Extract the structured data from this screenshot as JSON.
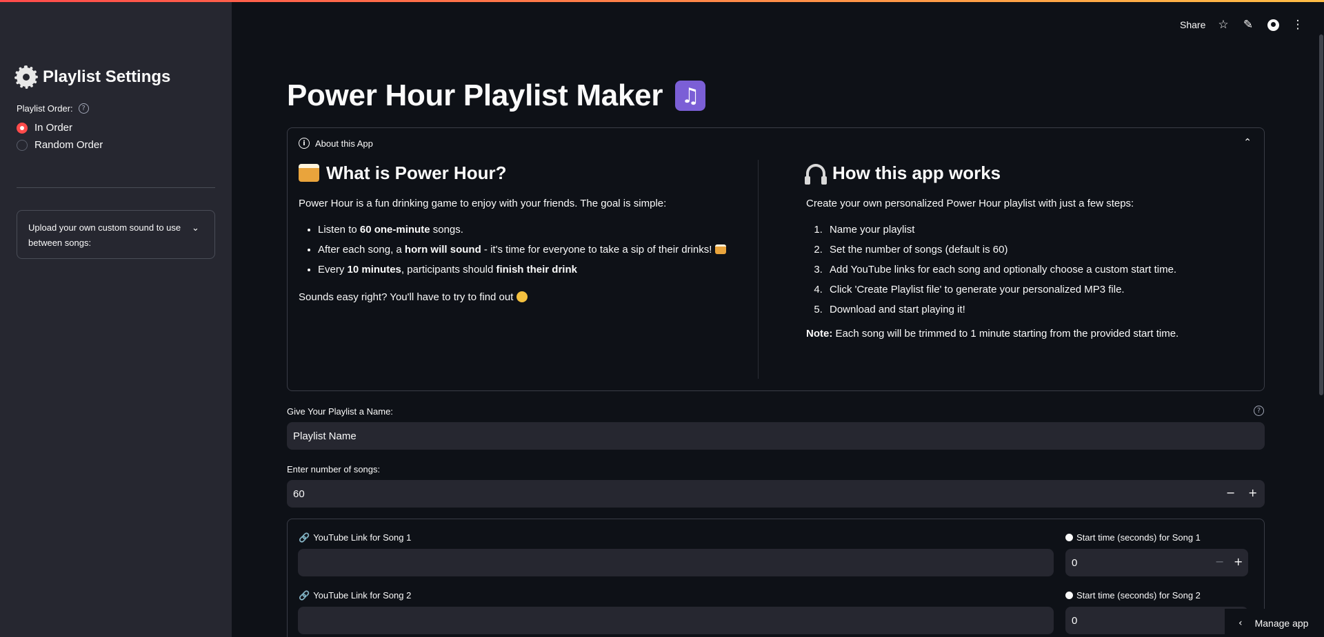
{
  "sidebar": {
    "title": "Playlist Settings",
    "order_label": "Playlist Order:",
    "help_glyph": "?",
    "options": [
      "In Order",
      "Random Order"
    ],
    "selected_option": "In Order",
    "upload_label": "Upload your own custom sound to use between songs:"
  },
  "header": {
    "share": "Share",
    "icons": [
      "star-icon",
      "pencil-icon",
      "github-icon",
      "more-vertical-icon"
    ]
  },
  "main": {
    "title": "Power Hour Playlist Maker",
    "about": {
      "label": "About this App",
      "left": {
        "heading": "What is Power Hour?",
        "intro": "Power Hour is a fun drinking game to enjoy with your friends. The goal is simple:",
        "bullets": [
          {
            "pre": "Listen to ",
            "bold": "60 one-minute",
            "post": " songs."
          },
          {
            "pre": "After each song, a ",
            "bold": "horn will sound",
            "post": " - it's time for everyone to take a sip of their drinks!"
          },
          {
            "pre": "Every ",
            "bold": "10 minutes",
            "post": ", participants should ",
            "bold2": "finish their drink"
          }
        ],
        "outro": "Sounds easy right? You'll have to try to find out"
      },
      "right": {
        "heading": "How this app works",
        "intro": "Create your own personalized Power Hour playlist with just a few steps:",
        "steps": [
          "Name your playlist",
          "Set the number of songs (default is 60)",
          "Add YouTube links for each song and optionally choose a custom start time.",
          "Click 'Create Playlist file' to generate your personalized MP3 file.",
          "Download and start playing it!"
        ],
        "note_label": "Note:",
        "note_text": " Each song will be trimmed to 1 minute starting from the provided start time."
      }
    },
    "name_field": {
      "label": "Give Your Playlist a Name:",
      "value": "Playlist Name"
    },
    "songs_field": {
      "label": "Enter number of songs:",
      "value": "60"
    },
    "songs": [
      {
        "link_label": "YouTube Link for Song 1",
        "link_value": "",
        "start_label": "Start time (seconds) for Song 1",
        "start_value": "0"
      },
      {
        "link_label": "YouTube Link for Song 2",
        "link_value": "",
        "start_label": "Start time (seconds) for Song 2",
        "start_value": "0"
      }
    ]
  },
  "footer": {
    "manage_app": "Manage app"
  },
  "colors": {
    "accent": "#ff4b4b",
    "background": "#0e1117",
    "sidebar": "#262730",
    "input": "#262730"
  }
}
